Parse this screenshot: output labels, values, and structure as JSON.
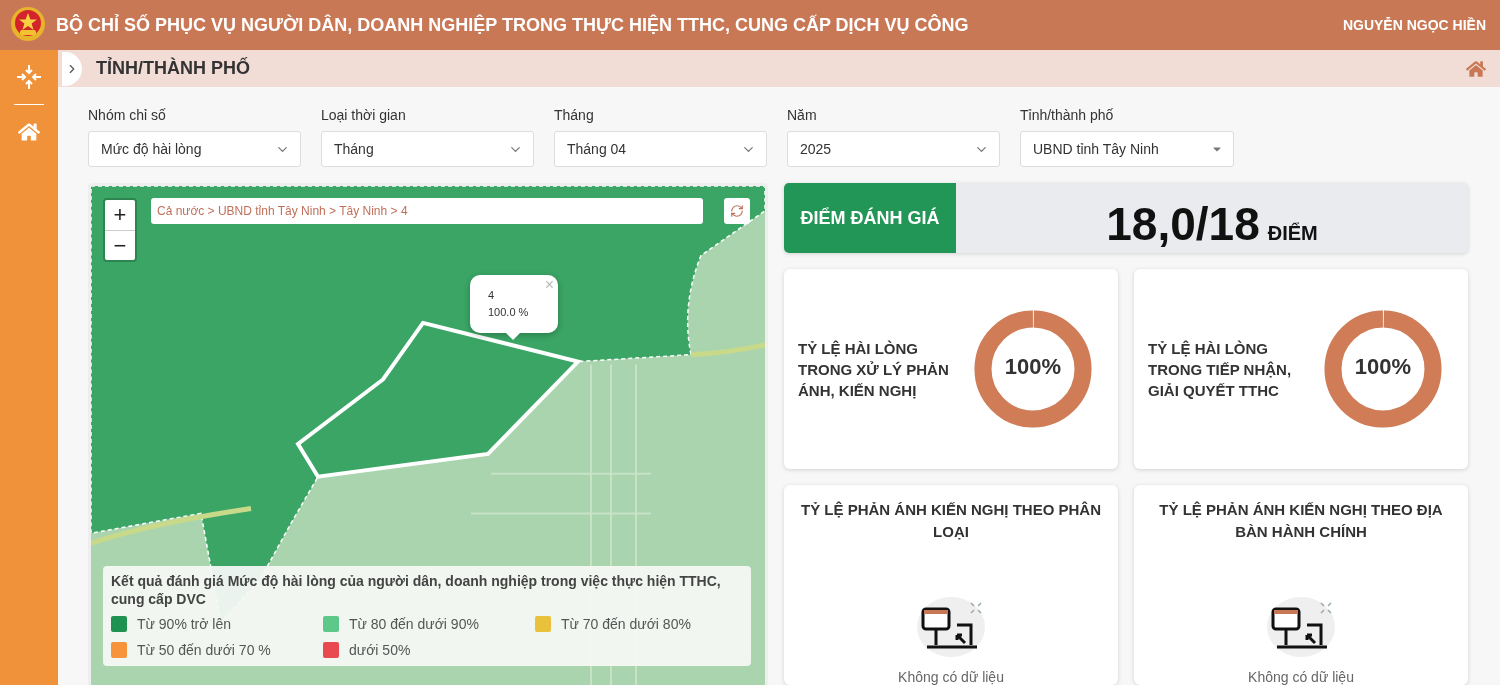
{
  "header": {
    "title": "BỘ CHỈ SỐ PHỤC VỤ NGƯỜI DÂN, DOANH NGHIỆP TRONG THỰC HIỆN TTHC, CUNG CẤP DỊCH VỤ CÔNG",
    "user": "NGUYỄN NGỌC HIỀN"
  },
  "page": {
    "title": "TỈNH/THÀNH PHỐ"
  },
  "filters": [
    {
      "label": "Nhóm chỉ số",
      "value": "Mức độ hài lòng",
      "kind": "chevron"
    },
    {
      "label": "Loại thời gian",
      "value": "Tháng",
      "kind": "chevron"
    },
    {
      "label": "Tháng",
      "value": "Tháng 04",
      "kind": "chevron"
    },
    {
      "label": "Năm",
      "value": "2025",
      "kind": "chevron"
    },
    {
      "label": "Tỉnh/thành phố",
      "value": "UBND tỉnh Tây Ninh",
      "kind": "caret"
    }
  ],
  "map": {
    "zoom_in": "+",
    "zoom_out": "−",
    "breadcrumb": "Cả nước > UBND tỉnh Tây Ninh > Tây Ninh > 4",
    "popup": {
      "name": "4",
      "value": "100.0 %",
      "close": "×"
    },
    "legend": {
      "title": "Kết quả đánh giá Mức độ hài lòng của người dân, doanh nghiệp trong việc thực hiện TTHC, cung cấp DVC",
      "items": [
        {
          "label": "Từ 90% trở lên",
          "color": "#1f9150"
        },
        {
          "label": "Từ 80 đến dưới 90%",
          "color": "#5cc98a"
        },
        {
          "label": "Từ 70 đến dưới 80%",
          "color": "#e9c13b"
        },
        {
          "label": "Từ 50 đến dưới 70 %",
          "color": "#f7933a"
        },
        {
          "label": "dưới 50%",
          "color": "#e84a4f"
        }
      ]
    }
  },
  "score": {
    "label": "ĐIỂM ĐÁNH GIÁ",
    "value": "18,0/18",
    "unit": "ĐIỂM"
  },
  "rates": [
    {
      "title": "TỶ LỆ HÀI LÒNG TRONG XỬ LÝ PHẢN ÁNH, KIẾN NGHỊ",
      "reading": "100%",
      "level": 1
    },
    {
      "title": "TỶ LỆ HÀI LÒNG TRONG TIẾP NHẬN, GIẢI QUYẾT TTHC",
      "reading": "100%",
      "level": 1
    }
  ],
  "breakdowns": [
    {
      "title": "TỶ LỆ PHẢN ÁNH KIẾN NGHỊ THEO PHÂN LOẠI",
      "empty_text": "Không có dữ liệu"
    },
    {
      "title": "TỶ LỆ PHẢN ÁNH KIẾN NGHỊ THEO ĐỊA BÀN HÀNH CHÍNH",
      "empty_text": "Không có dữ liệu"
    }
  ]
}
